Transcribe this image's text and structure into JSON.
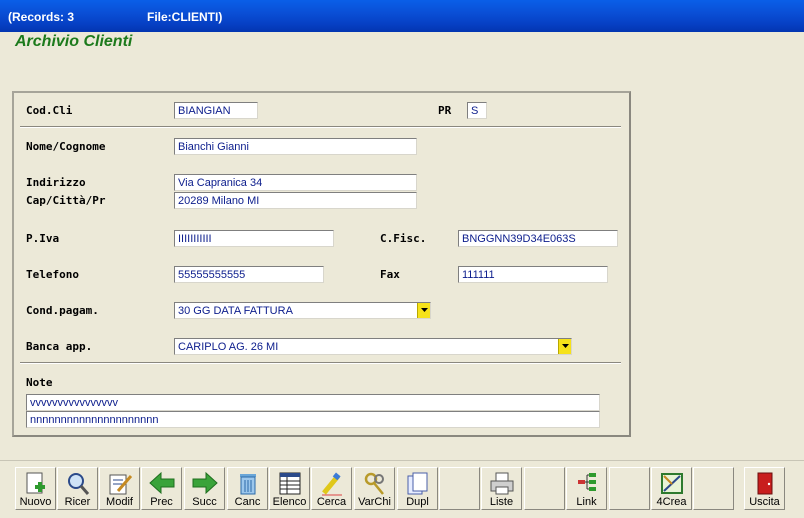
{
  "titlebar": {
    "records": "(Records: 3",
    "file": "File:CLIENTI)"
  },
  "form": {
    "title": "Archivio Clienti"
  },
  "fields": {
    "cod_cli": {
      "label": "Cod.Cli",
      "value": "BIANGIAN"
    },
    "pr": {
      "label": "PR",
      "value": "S"
    },
    "nome": {
      "label": "Nome/Cognome",
      "value": "Bianchi Gianni"
    },
    "indirizzo": {
      "label": "Indirizzo",
      "value": "Via Capranica 34"
    },
    "cap": {
      "label": "Cap/Città/Pr",
      "value": "20289 Milano MI"
    },
    "piva": {
      "label": "P.Iva",
      "value": "IIIIIIIIIII"
    },
    "cfisc": {
      "label": "C.Fisc.",
      "value": "BNGGNN39D34E063S"
    },
    "telefono": {
      "label": "Telefono",
      "value": "55555555555"
    },
    "fax": {
      "label": "Fax",
      "value": "111111"
    },
    "cond_pagam": {
      "label": "Cond.pagam.",
      "value": "30 GG DATA FATTURA"
    },
    "banca": {
      "label": "Banca app.",
      "value": "CARIPLO AG. 26 MI"
    },
    "note": {
      "label": "Note",
      "line1": "vvvvvvvvvvvvvvvv",
      "line2": "nnnnnnnnnnnnnnnnnnnnn"
    }
  },
  "toolbar": {
    "nuovo": "Nuovo",
    "ricer": "Ricer",
    "modif": "Modif",
    "prec": "Prec",
    "succ": "Succ",
    "canc": "Canc",
    "elenco": "Elenco",
    "cerca": "Cerca",
    "varchi": "VarChi",
    "dupl": "Dupl",
    "liste": "Liste",
    "link": "Link",
    "crea": "4Crea",
    "uscita": "Uscita"
  },
  "colors": {
    "titlebar": "#0a4fd6",
    "form_title": "#1c7a1c",
    "field_text": "#0b1c8c",
    "dropdown": "#f6e21a"
  }
}
